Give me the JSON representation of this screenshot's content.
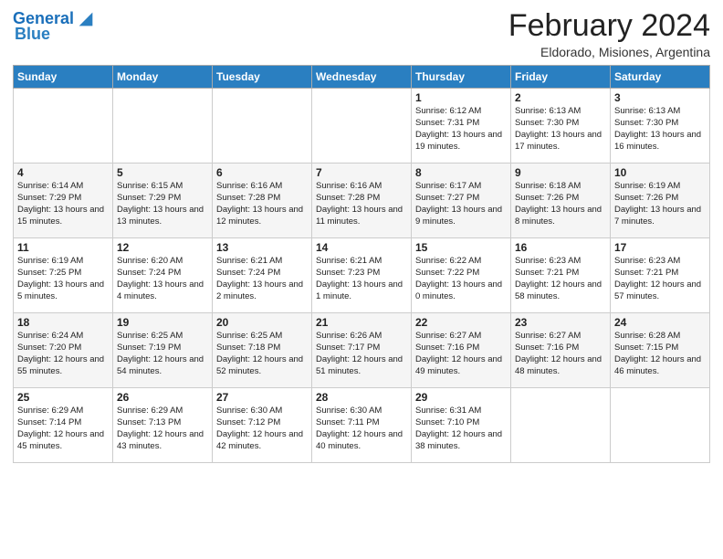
{
  "header": {
    "logo_general": "General",
    "logo_blue": "Blue",
    "title": "February 2024",
    "subtitle": "Eldorado, Misiones, Argentina"
  },
  "days_of_week": [
    "Sunday",
    "Monday",
    "Tuesday",
    "Wednesday",
    "Thursday",
    "Friday",
    "Saturday"
  ],
  "weeks": [
    [
      {
        "day": "",
        "info": ""
      },
      {
        "day": "",
        "info": ""
      },
      {
        "day": "",
        "info": ""
      },
      {
        "day": "",
        "info": ""
      },
      {
        "day": "1",
        "info": "Sunrise: 6:12 AM\nSunset: 7:31 PM\nDaylight: 13 hours and 19 minutes."
      },
      {
        "day": "2",
        "info": "Sunrise: 6:13 AM\nSunset: 7:30 PM\nDaylight: 13 hours and 17 minutes."
      },
      {
        "day": "3",
        "info": "Sunrise: 6:13 AM\nSunset: 7:30 PM\nDaylight: 13 hours and 16 minutes."
      }
    ],
    [
      {
        "day": "4",
        "info": "Sunrise: 6:14 AM\nSunset: 7:29 PM\nDaylight: 13 hours and 15 minutes."
      },
      {
        "day": "5",
        "info": "Sunrise: 6:15 AM\nSunset: 7:29 PM\nDaylight: 13 hours and 13 minutes."
      },
      {
        "day": "6",
        "info": "Sunrise: 6:16 AM\nSunset: 7:28 PM\nDaylight: 13 hours and 12 minutes."
      },
      {
        "day": "7",
        "info": "Sunrise: 6:16 AM\nSunset: 7:28 PM\nDaylight: 13 hours and 11 minutes."
      },
      {
        "day": "8",
        "info": "Sunrise: 6:17 AM\nSunset: 7:27 PM\nDaylight: 13 hours and 9 minutes."
      },
      {
        "day": "9",
        "info": "Sunrise: 6:18 AM\nSunset: 7:26 PM\nDaylight: 13 hours and 8 minutes."
      },
      {
        "day": "10",
        "info": "Sunrise: 6:19 AM\nSunset: 7:26 PM\nDaylight: 13 hours and 7 minutes."
      }
    ],
    [
      {
        "day": "11",
        "info": "Sunrise: 6:19 AM\nSunset: 7:25 PM\nDaylight: 13 hours and 5 minutes."
      },
      {
        "day": "12",
        "info": "Sunrise: 6:20 AM\nSunset: 7:24 PM\nDaylight: 13 hours and 4 minutes."
      },
      {
        "day": "13",
        "info": "Sunrise: 6:21 AM\nSunset: 7:24 PM\nDaylight: 13 hours and 2 minutes."
      },
      {
        "day": "14",
        "info": "Sunrise: 6:21 AM\nSunset: 7:23 PM\nDaylight: 13 hours and 1 minute."
      },
      {
        "day": "15",
        "info": "Sunrise: 6:22 AM\nSunset: 7:22 PM\nDaylight: 13 hours and 0 minutes."
      },
      {
        "day": "16",
        "info": "Sunrise: 6:23 AM\nSunset: 7:21 PM\nDaylight: 12 hours and 58 minutes."
      },
      {
        "day": "17",
        "info": "Sunrise: 6:23 AM\nSunset: 7:21 PM\nDaylight: 12 hours and 57 minutes."
      }
    ],
    [
      {
        "day": "18",
        "info": "Sunrise: 6:24 AM\nSunset: 7:20 PM\nDaylight: 12 hours and 55 minutes."
      },
      {
        "day": "19",
        "info": "Sunrise: 6:25 AM\nSunset: 7:19 PM\nDaylight: 12 hours and 54 minutes."
      },
      {
        "day": "20",
        "info": "Sunrise: 6:25 AM\nSunset: 7:18 PM\nDaylight: 12 hours and 52 minutes."
      },
      {
        "day": "21",
        "info": "Sunrise: 6:26 AM\nSunset: 7:17 PM\nDaylight: 12 hours and 51 minutes."
      },
      {
        "day": "22",
        "info": "Sunrise: 6:27 AM\nSunset: 7:16 PM\nDaylight: 12 hours and 49 minutes."
      },
      {
        "day": "23",
        "info": "Sunrise: 6:27 AM\nSunset: 7:16 PM\nDaylight: 12 hours and 48 minutes."
      },
      {
        "day": "24",
        "info": "Sunrise: 6:28 AM\nSunset: 7:15 PM\nDaylight: 12 hours and 46 minutes."
      }
    ],
    [
      {
        "day": "25",
        "info": "Sunrise: 6:29 AM\nSunset: 7:14 PM\nDaylight: 12 hours and 45 minutes."
      },
      {
        "day": "26",
        "info": "Sunrise: 6:29 AM\nSunset: 7:13 PM\nDaylight: 12 hours and 43 minutes."
      },
      {
        "day": "27",
        "info": "Sunrise: 6:30 AM\nSunset: 7:12 PM\nDaylight: 12 hours and 42 minutes."
      },
      {
        "day": "28",
        "info": "Sunrise: 6:30 AM\nSunset: 7:11 PM\nDaylight: 12 hours and 40 minutes."
      },
      {
        "day": "29",
        "info": "Sunrise: 6:31 AM\nSunset: 7:10 PM\nDaylight: 12 hours and 38 minutes."
      },
      {
        "day": "",
        "info": ""
      },
      {
        "day": "",
        "info": ""
      }
    ]
  ]
}
